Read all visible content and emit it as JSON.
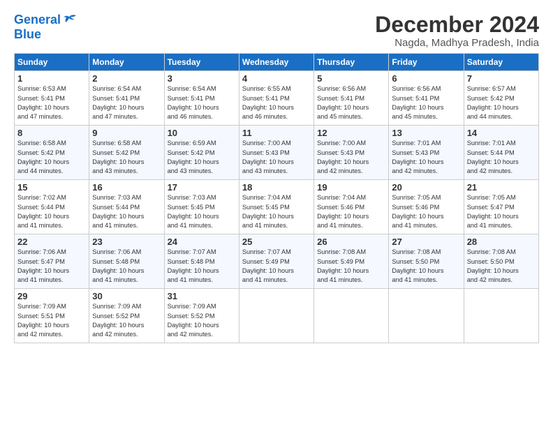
{
  "header": {
    "logo_line1": "General",
    "logo_line2": "Blue",
    "month_title": "December 2024",
    "location": "Nagda, Madhya Pradesh, India"
  },
  "calendar": {
    "days_of_week": [
      "Sunday",
      "Monday",
      "Tuesday",
      "Wednesday",
      "Thursday",
      "Friday",
      "Saturday"
    ],
    "weeks": [
      [
        {
          "day": "1",
          "info": "Sunrise: 6:53 AM\nSunset: 5:41 PM\nDaylight: 10 hours\nand 47 minutes."
        },
        {
          "day": "2",
          "info": "Sunrise: 6:54 AM\nSunset: 5:41 PM\nDaylight: 10 hours\nand 47 minutes."
        },
        {
          "day": "3",
          "info": "Sunrise: 6:54 AM\nSunset: 5:41 PM\nDaylight: 10 hours\nand 46 minutes."
        },
        {
          "day": "4",
          "info": "Sunrise: 6:55 AM\nSunset: 5:41 PM\nDaylight: 10 hours\nand 46 minutes."
        },
        {
          "day": "5",
          "info": "Sunrise: 6:56 AM\nSunset: 5:41 PM\nDaylight: 10 hours\nand 45 minutes."
        },
        {
          "day": "6",
          "info": "Sunrise: 6:56 AM\nSunset: 5:41 PM\nDaylight: 10 hours\nand 45 minutes."
        },
        {
          "day": "7",
          "info": "Sunrise: 6:57 AM\nSunset: 5:42 PM\nDaylight: 10 hours\nand 44 minutes."
        }
      ],
      [
        {
          "day": "8",
          "info": "Sunrise: 6:58 AM\nSunset: 5:42 PM\nDaylight: 10 hours\nand 44 minutes."
        },
        {
          "day": "9",
          "info": "Sunrise: 6:58 AM\nSunset: 5:42 PM\nDaylight: 10 hours\nand 43 minutes."
        },
        {
          "day": "10",
          "info": "Sunrise: 6:59 AM\nSunset: 5:42 PM\nDaylight: 10 hours\nand 43 minutes."
        },
        {
          "day": "11",
          "info": "Sunrise: 7:00 AM\nSunset: 5:43 PM\nDaylight: 10 hours\nand 43 minutes."
        },
        {
          "day": "12",
          "info": "Sunrise: 7:00 AM\nSunset: 5:43 PM\nDaylight: 10 hours\nand 42 minutes."
        },
        {
          "day": "13",
          "info": "Sunrise: 7:01 AM\nSunset: 5:43 PM\nDaylight: 10 hours\nand 42 minutes."
        },
        {
          "day": "14",
          "info": "Sunrise: 7:01 AM\nSunset: 5:44 PM\nDaylight: 10 hours\nand 42 minutes."
        }
      ],
      [
        {
          "day": "15",
          "info": "Sunrise: 7:02 AM\nSunset: 5:44 PM\nDaylight: 10 hours\nand 41 minutes."
        },
        {
          "day": "16",
          "info": "Sunrise: 7:03 AM\nSunset: 5:44 PM\nDaylight: 10 hours\nand 41 minutes."
        },
        {
          "day": "17",
          "info": "Sunrise: 7:03 AM\nSunset: 5:45 PM\nDaylight: 10 hours\nand 41 minutes."
        },
        {
          "day": "18",
          "info": "Sunrise: 7:04 AM\nSunset: 5:45 PM\nDaylight: 10 hours\nand 41 minutes."
        },
        {
          "day": "19",
          "info": "Sunrise: 7:04 AM\nSunset: 5:46 PM\nDaylight: 10 hours\nand 41 minutes."
        },
        {
          "day": "20",
          "info": "Sunrise: 7:05 AM\nSunset: 5:46 PM\nDaylight: 10 hours\nand 41 minutes."
        },
        {
          "day": "21",
          "info": "Sunrise: 7:05 AM\nSunset: 5:47 PM\nDaylight: 10 hours\nand 41 minutes."
        }
      ],
      [
        {
          "day": "22",
          "info": "Sunrise: 7:06 AM\nSunset: 5:47 PM\nDaylight: 10 hours\nand 41 minutes."
        },
        {
          "day": "23",
          "info": "Sunrise: 7:06 AM\nSunset: 5:48 PM\nDaylight: 10 hours\nand 41 minutes."
        },
        {
          "day": "24",
          "info": "Sunrise: 7:07 AM\nSunset: 5:48 PM\nDaylight: 10 hours\nand 41 minutes."
        },
        {
          "day": "25",
          "info": "Sunrise: 7:07 AM\nSunset: 5:49 PM\nDaylight: 10 hours\nand 41 minutes."
        },
        {
          "day": "26",
          "info": "Sunrise: 7:08 AM\nSunset: 5:49 PM\nDaylight: 10 hours\nand 41 minutes."
        },
        {
          "day": "27",
          "info": "Sunrise: 7:08 AM\nSunset: 5:50 PM\nDaylight: 10 hours\nand 41 minutes."
        },
        {
          "day": "28",
          "info": "Sunrise: 7:08 AM\nSunset: 5:50 PM\nDaylight: 10 hours\nand 42 minutes."
        }
      ],
      [
        {
          "day": "29",
          "info": "Sunrise: 7:09 AM\nSunset: 5:51 PM\nDaylight: 10 hours\nand 42 minutes."
        },
        {
          "day": "30",
          "info": "Sunrise: 7:09 AM\nSunset: 5:52 PM\nDaylight: 10 hours\nand 42 minutes."
        },
        {
          "day": "31",
          "info": "Sunrise: 7:09 AM\nSunset: 5:52 PM\nDaylight: 10 hours\nand 42 minutes."
        },
        {
          "day": "",
          "info": ""
        },
        {
          "day": "",
          "info": ""
        },
        {
          "day": "",
          "info": ""
        },
        {
          "day": "",
          "info": ""
        }
      ]
    ]
  }
}
